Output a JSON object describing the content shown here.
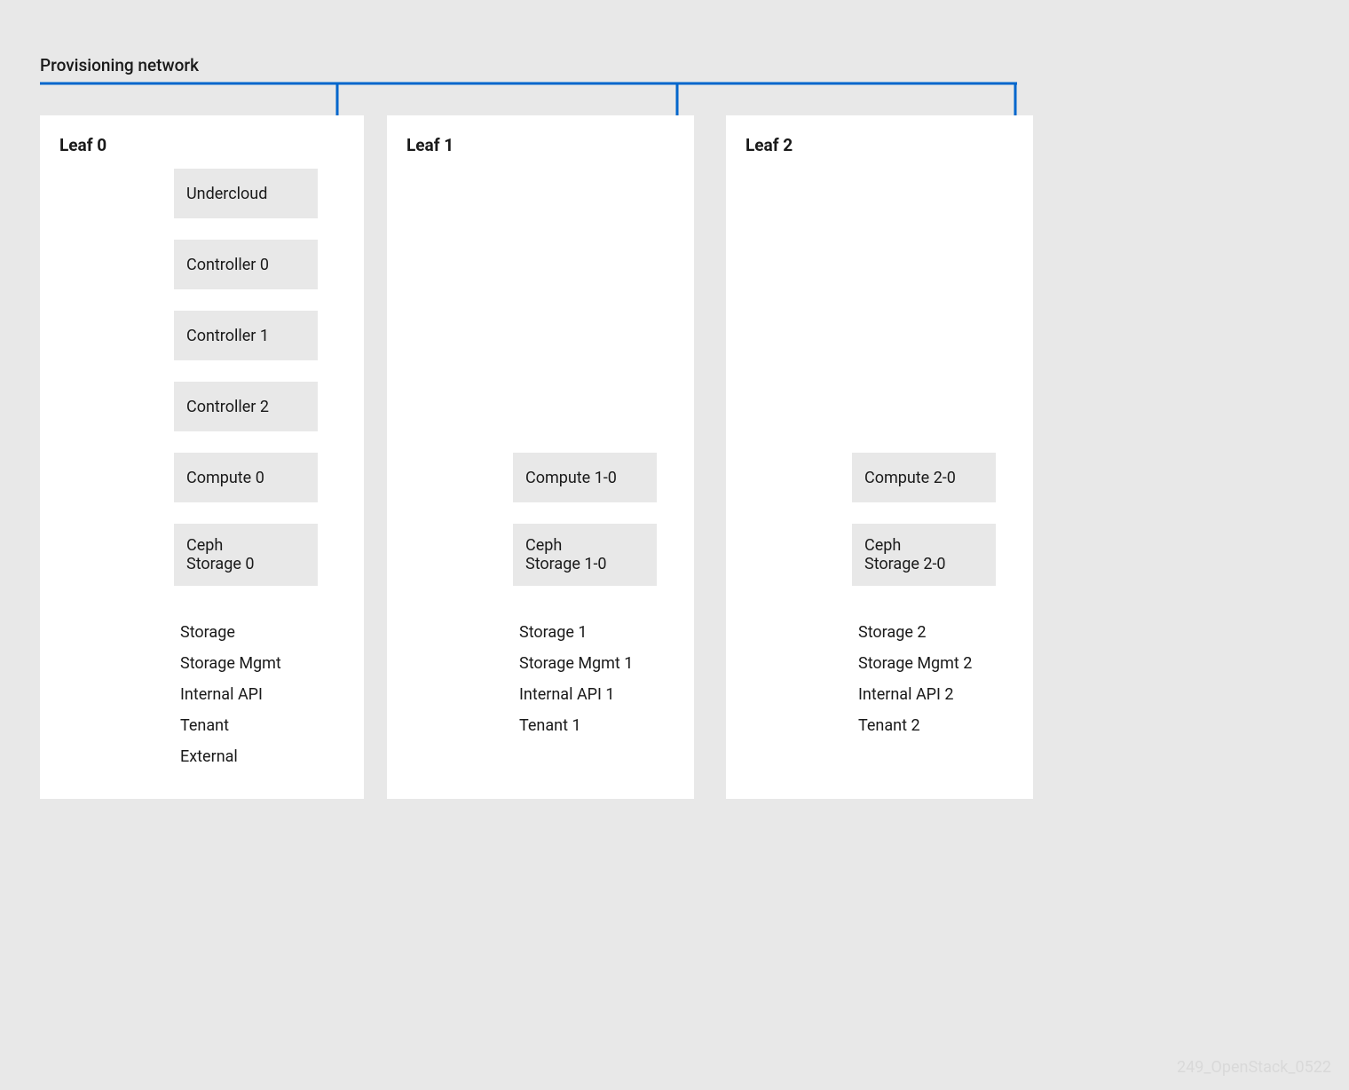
{
  "title": "Provisioning network",
  "watermark": "249_OpenStack_0522",
  "colors": {
    "provisioning": "#0066cc",
    "storage": "#ec7a08",
    "storage_mgmt": "#f0ab00",
    "internal_api": "#a8d76b",
    "tenant": "#35caed",
    "external": "#a28ad6"
  },
  "leaves": [
    {
      "title": "Leaf 0",
      "nodes": [
        "Undercloud",
        "Controller 0",
        "Controller 1",
        "Controller 2",
        "Compute 0",
        "Ceph\nStorage 0"
      ],
      "networks": [
        "Storage",
        "Storage Mgmt",
        "Internal API",
        "Tenant",
        "External"
      ]
    },
    {
      "title": "Leaf 1",
      "nodes": [
        "Compute 1-0",
        "Ceph\nStorage 1-0"
      ],
      "networks": [
        "Storage 1",
        "Storage Mgmt 1",
        "Internal API 1",
        "Tenant 1"
      ]
    },
    {
      "title": "Leaf 2",
      "nodes": [
        "Compute 2-0",
        "Ceph\nStorage 2-0"
      ],
      "networks": [
        "Storage 2",
        "Storage Mgmt 2",
        "Internal API 2",
        "Tenant 2"
      ]
    }
  ]
}
